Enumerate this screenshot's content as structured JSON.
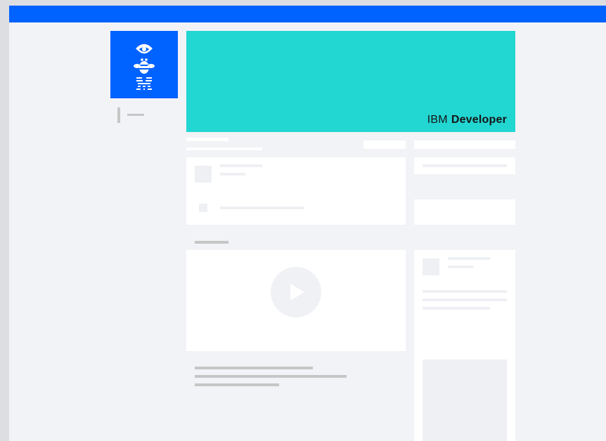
{
  "header": {
    "bar_color": "#0062ff"
  },
  "logo": {
    "icon": "ibm-bee-logo-icon",
    "background": "#0062ff"
  },
  "banner": {
    "background": "#22d6d2",
    "brand_light": "IBM",
    "brand_bold": "Developer"
  },
  "video": {
    "icon": "play-icon"
  },
  "colors": {
    "page_bg": "#f2f3f6",
    "card_bg": "#ffffff",
    "placeholder": "#c6c6c6",
    "skeleton_block": "#eef0f3"
  }
}
